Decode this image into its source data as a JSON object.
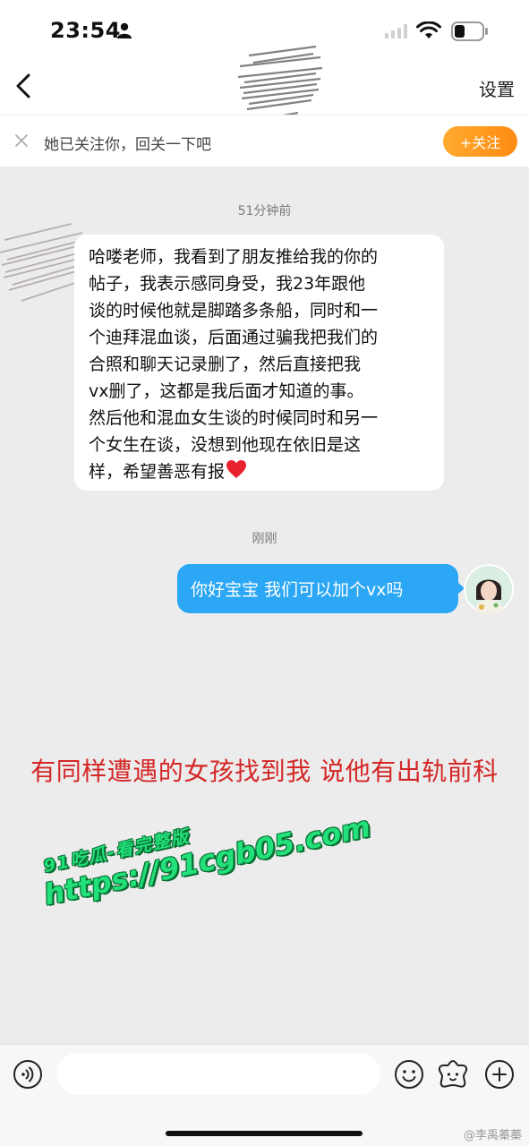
{
  "status_bar": {
    "time": "23:54"
  },
  "nav": {
    "settings_label": "设置"
  },
  "follow_banner": {
    "text": "她已关注你，回关一下吧",
    "button_label": "+关注",
    "accent": "#ff9a1f"
  },
  "chat": {
    "timestamp_1": "51分钟前",
    "incoming_lines": [
      "哈喽老师，我看到了朋友推给我的你的",
      "帖子，我表示感同身受，我23年跟他",
      "谈的时候他就是脚踏多条船，同时和一",
      "个迪拜混血谈，后面通过骗我把我们的",
      "合照和聊天记录删了，然后直接把我",
      "vx删了，这都是我后面才知道的事。",
      "然后他和混血女生谈的时候同时和另一",
      "个女生在谈，没想到他现在依旧是这",
      "样，希望善恶有报"
    ],
    "timestamp_2": "刚刚",
    "outgoing_text": "你好宝宝 我们可以加个vx吗",
    "bubble_color": "#2ba7f5"
  },
  "overlay_caption": "有同样遭遇的女孩找到我 说他有出轨前科",
  "watermark": {
    "line1": "91吃瓜-看完整版",
    "line2": "https://91cgb05.com"
  },
  "input_bar": {
    "placeholder": ""
  },
  "credit": "@李禹蓁蓁",
  "icons": {
    "status": [
      "person-icon",
      "signal-icon",
      "wifi-icon",
      "battery-icon"
    ],
    "nav": [
      "back-icon"
    ],
    "banner": [
      "close-icon"
    ],
    "input": [
      "voice-icon",
      "emoji-icon",
      "sticker-icon",
      "plus-icon"
    ]
  }
}
